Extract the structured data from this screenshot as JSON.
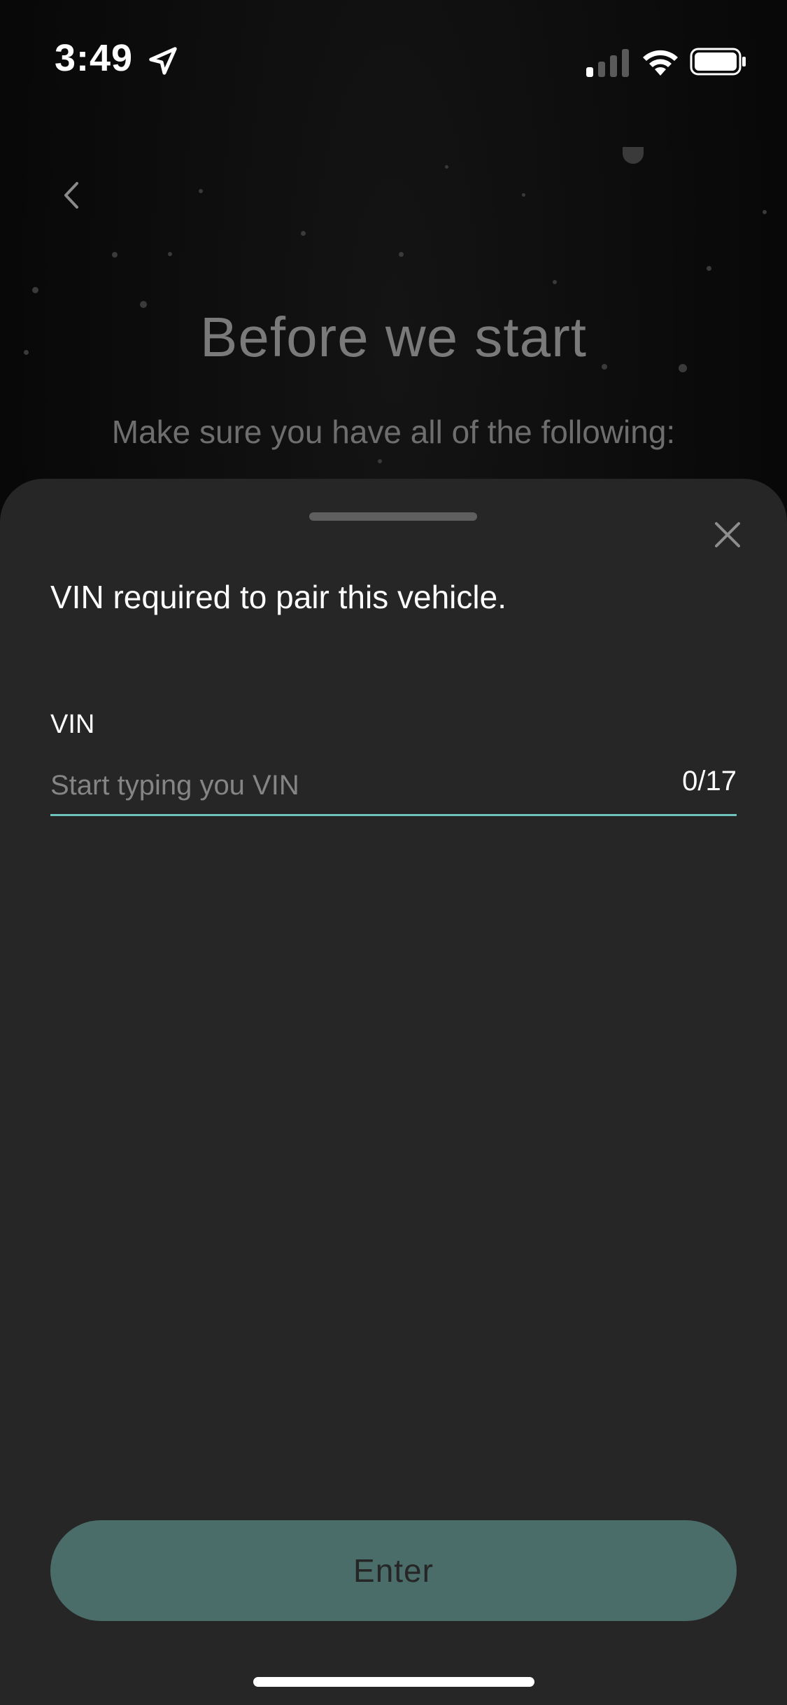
{
  "status_bar": {
    "time": "3:49",
    "icons": [
      "location-arrow-icon",
      "cellular-signal-icon",
      "wifi-icon",
      "battery-icon"
    ]
  },
  "background_page": {
    "back_icon": "chevron-left-icon",
    "title": "Before we start",
    "subtitle": "Make sure you have all of the following:"
  },
  "sheet": {
    "close_icon": "close-icon",
    "heading": "VIN required to pair this vehicle.",
    "vin_field": {
      "label": "VIN",
      "value": "",
      "placeholder": "Start typing you VIN",
      "counter": "0/17"
    },
    "enter_button": {
      "label": "Enter"
    }
  },
  "colors": {
    "sheet_background": "#262626",
    "accent_underline": "#6ec3bd",
    "button_background": "#4a6d69",
    "text_primary": "#ffffff",
    "text_placeholder": "#858585"
  }
}
